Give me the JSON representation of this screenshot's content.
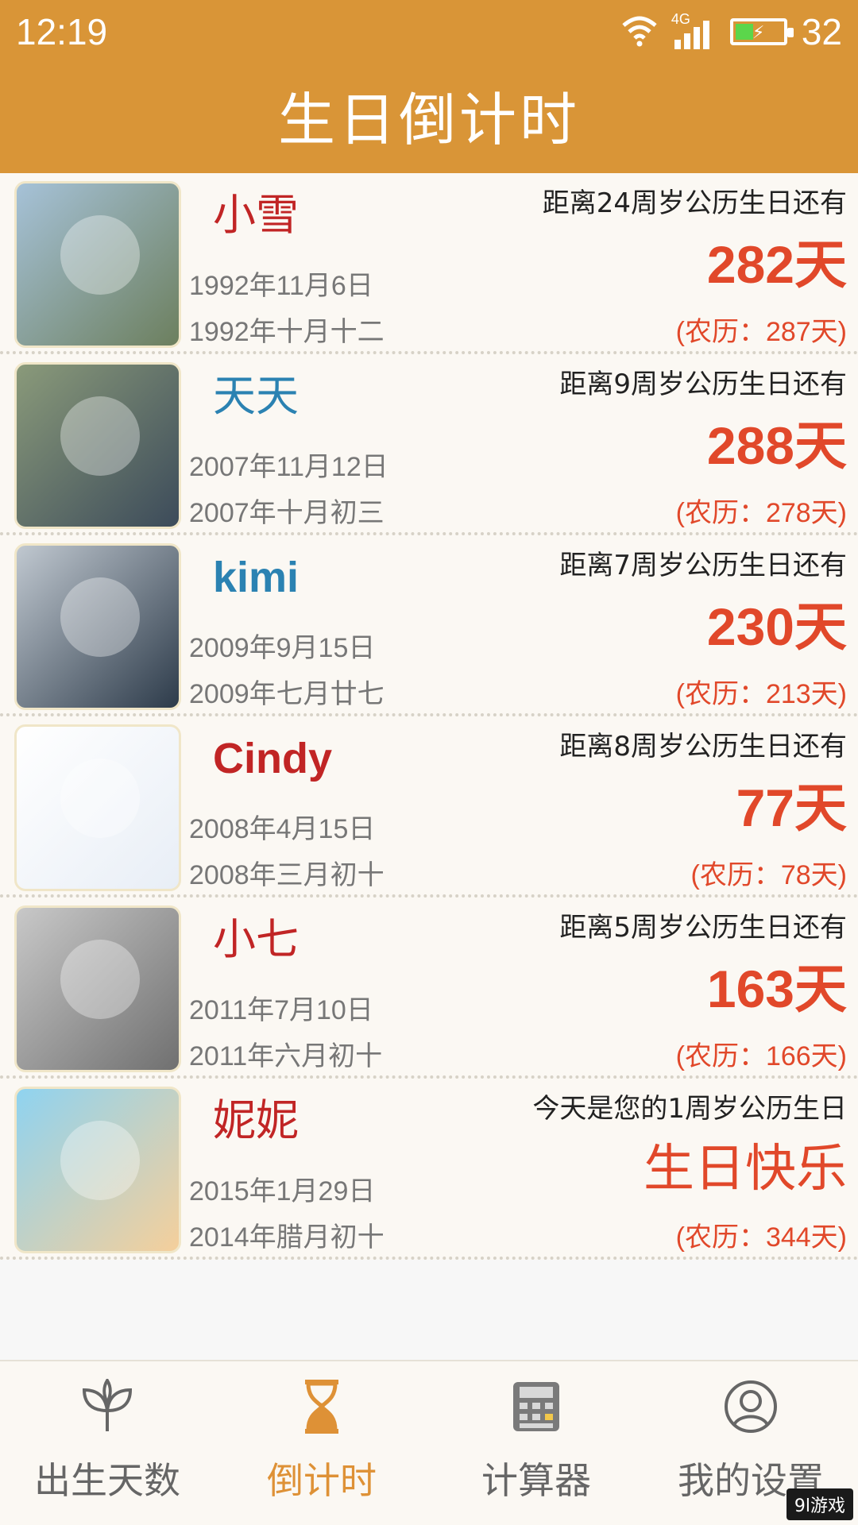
{
  "status_bar": {
    "time": "12:19",
    "battery": "32",
    "network": "4G"
  },
  "header": {
    "title": "生日倒计时"
  },
  "list": [
    {
      "name": "小雪",
      "name_color": "red",
      "caption": "距离24周岁公历生日还有",
      "solar": "1992年11月6日",
      "lunar": "1992年十月十二",
      "days": "282天",
      "lunar_days": "(农历：287天)"
    },
    {
      "name": "天天",
      "name_color": "blue",
      "caption": "距离9周岁公历生日还有",
      "solar": "2007年11月12日",
      "lunar": "2007年十月初三",
      "days": "288天",
      "lunar_days": "(农历：278天)"
    },
    {
      "name": "kimi",
      "name_color": "blue",
      "caption": "距离7周岁公历生日还有",
      "solar": "2009年9月15日",
      "lunar": "2009年七月廿七",
      "days": "230天",
      "lunar_days": "(农历：213天)"
    },
    {
      "name": "Cindy",
      "name_color": "red",
      "caption": "距离8周岁公历生日还有",
      "solar": "2008年4月15日",
      "lunar": "2008年三月初十",
      "days": "77天",
      "lunar_days": "(农历：78天)"
    },
    {
      "name": "小七",
      "name_color": "red",
      "caption": "距离5周岁公历生日还有",
      "solar": "2011年7月10日",
      "lunar": "2011年六月初十",
      "days": "163天",
      "lunar_days": "(农历：166天)"
    },
    {
      "name": "妮妮",
      "name_color": "red",
      "caption": "今天是您的1周岁公历生日",
      "solar": "2015年1月29日",
      "lunar": "2014年腊月初十",
      "days": "生日快乐",
      "lunar_days": "(农历：344天)"
    }
  ],
  "tabs": [
    {
      "label": "出生天数",
      "icon": "sprout-icon"
    },
    {
      "label": "倒计时",
      "icon": "hourglass-icon"
    },
    {
      "label": "计算器",
      "icon": "calculator-icon"
    },
    {
      "label": "我的设置",
      "icon": "user-icon"
    }
  ],
  "watermark": "9l游戏",
  "colors": {
    "accent": "#d99537",
    "days": "#e1482a",
    "tab_active": "#de9136"
  }
}
